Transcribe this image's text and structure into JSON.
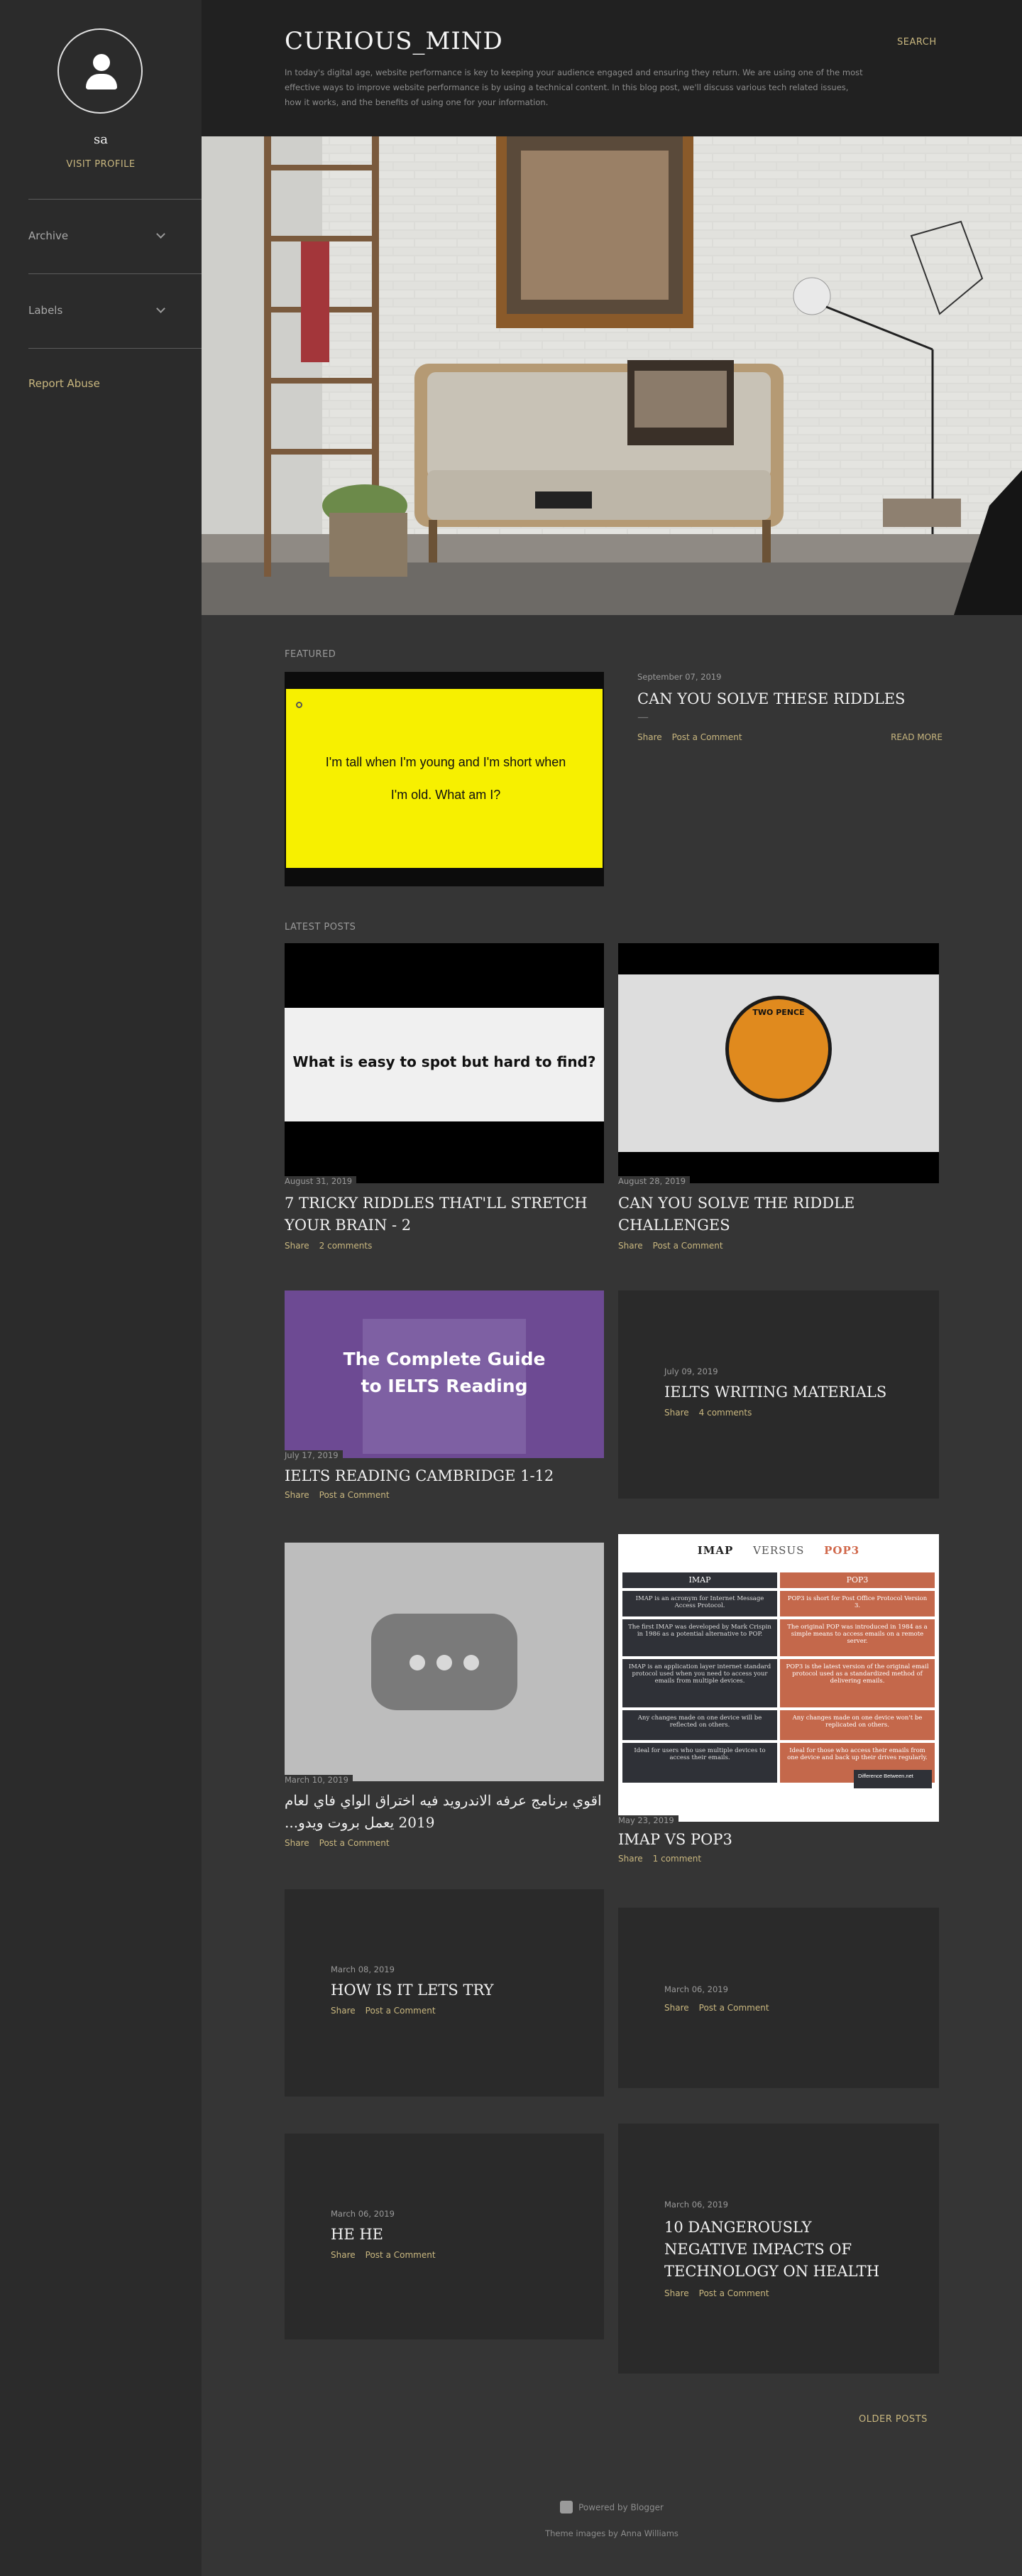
{
  "profile": {
    "name": "sa",
    "visit_label": "VISIT PROFILE"
  },
  "sidebar": {
    "archive_label": "Archive",
    "labels_label": "Labels",
    "report_label": "Report Abuse"
  },
  "header": {
    "title": "CURIOUS_MIND",
    "description": "In today's digital age, website performance is key to keeping your audience engaged and ensuring they return. We are using one of the most effective ways to improve website performance is by using a technical content. In this blog post, we'll discuss various tech related issues, how it works, and the benefits of using one for your information.",
    "search_label": "SEARCH"
  },
  "featured": {
    "section_label": "FEATURED",
    "image_text": "I'm tall when I'm young and I'm short when I'm old.  What am I?",
    "date": "September 07, 2019",
    "title": "CAN YOU SOLVE THESE RIDDLES",
    "share": "Share",
    "comment": "Post a Comment",
    "read_more": "READ MORE"
  },
  "latest": {
    "section_label": "LATEST POSTS",
    "posts": [
      {
        "date": "August 31, 2019",
        "title": "7 TRICKY RIDDLES THAT'LL STRETCH YOUR BRAIN - 2",
        "share": "Share",
        "comment": "2 comments",
        "image_text": "What is easy to spot but hard to find?"
      },
      {
        "date": "August 28, 2019",
        "title": "CAN YOU SOLVE THE RIDDLE CHALLENGES",
        "share": "Share",
        "comment": "Post a Comment",
        "image_text": "TWO PENCE"
      },
      {
        "date": "July 17, 2019",
        "title": "IELTS READING CAMBRIDGE 1-12",
        "share": "Share",
        "comment": "Post a Comment",
        "image_text": "The Complete Guide to IELTS Reading"
      },
      {
        "date": "July 09, 2019",
        "title": "IELTS WRITING MATERIALS",
        "share": "Share",
        "comment": "4 comments"
      },
      {
        "date": "March 10, 2019",
        "title": "اقوي برنامج عرفه الاندرويد فيه اختراق الواي فاي لعام 2019 يعمل بروت ويدو...",
        "share": "Share",
        "comment": "Post a Comment"
      },
      {
        "date": "May 23, 2019",
        "title": "IMAP VS POP3",
        "share": "Share",
        "comment": "1 comment"
      },
      {
        "date": "March 08, 2019",
        "title": "HOW IS IT LETS TRY",
        "share": "Share",
        "comment": "Post a Comment"
      },
      {
        "date": "March 06, 2019",
        "title": "",
        "share": "Share",
        "comment": "Post a Comment"
      },
      {
        "date": "March 06, 2019",
        "title": "HE HE",
        "share": "Share",
        "comment": "Post a Comment"
      },
      {
        "date": "March 06, 2019",
        "title": "10 DANGEROUSLY NEGATIVE IMPACTS OF TECHNOLOGY ON HEALTH",
        "share": "Share",
        "comment": "Post a Comment"
      }
    ]
  },
  "imap_table": {
    "head_left": "IMAP",
    "head_mid": "VERSUS",
    "head_right": "POP3",
    "col_left": "IMAP",
    "col_right": "POP3",
    "rows": [
      [
        "IMAP is an acronym for Internet Message Access Protocol.",
        "POP3 is short for Post Office Protocol Version 3."
      ],
      [
        "The first IMAP was developed by Mark Crispin in 1986 as a potential alternative to POP.",
        "The original POP was introduced in 1984 as a simple means to access emails on a remote server."
      ],
      [
        "IMAP is an application layer internet standard protocol used when you need to access your emails from multiple devices.",
        "POP3 is the latest version of the original email protocol used as a standardized method of delivering emails."
      ],
      [
        "Any changes made on one device will be reflected on others.",
        "Any changes made on one device won't be replicated on others."
      ],
      [
        "Ideal for users who use multiple devices to access their emails.",
        "Ideal for those who access their emails from one device and back up their drives regularly."
      ]
    ],
    "brand": "Difference Between.net"
  },
  "pager": {
    "older_label": "OLDER POSTS"
  },
  "footer": {
    "powered": "Powered by Blogger",
    "theme": "Theme images by Anna Williams"
  },
  "colors": {
    "accent": "#c9b77f",
    "page_bg": "#353535",
    "sidebar_bg": "#2b2b2b",
    "header_bg": "#212121",
    "card_bg": "#2a2a2a"
  }
}
